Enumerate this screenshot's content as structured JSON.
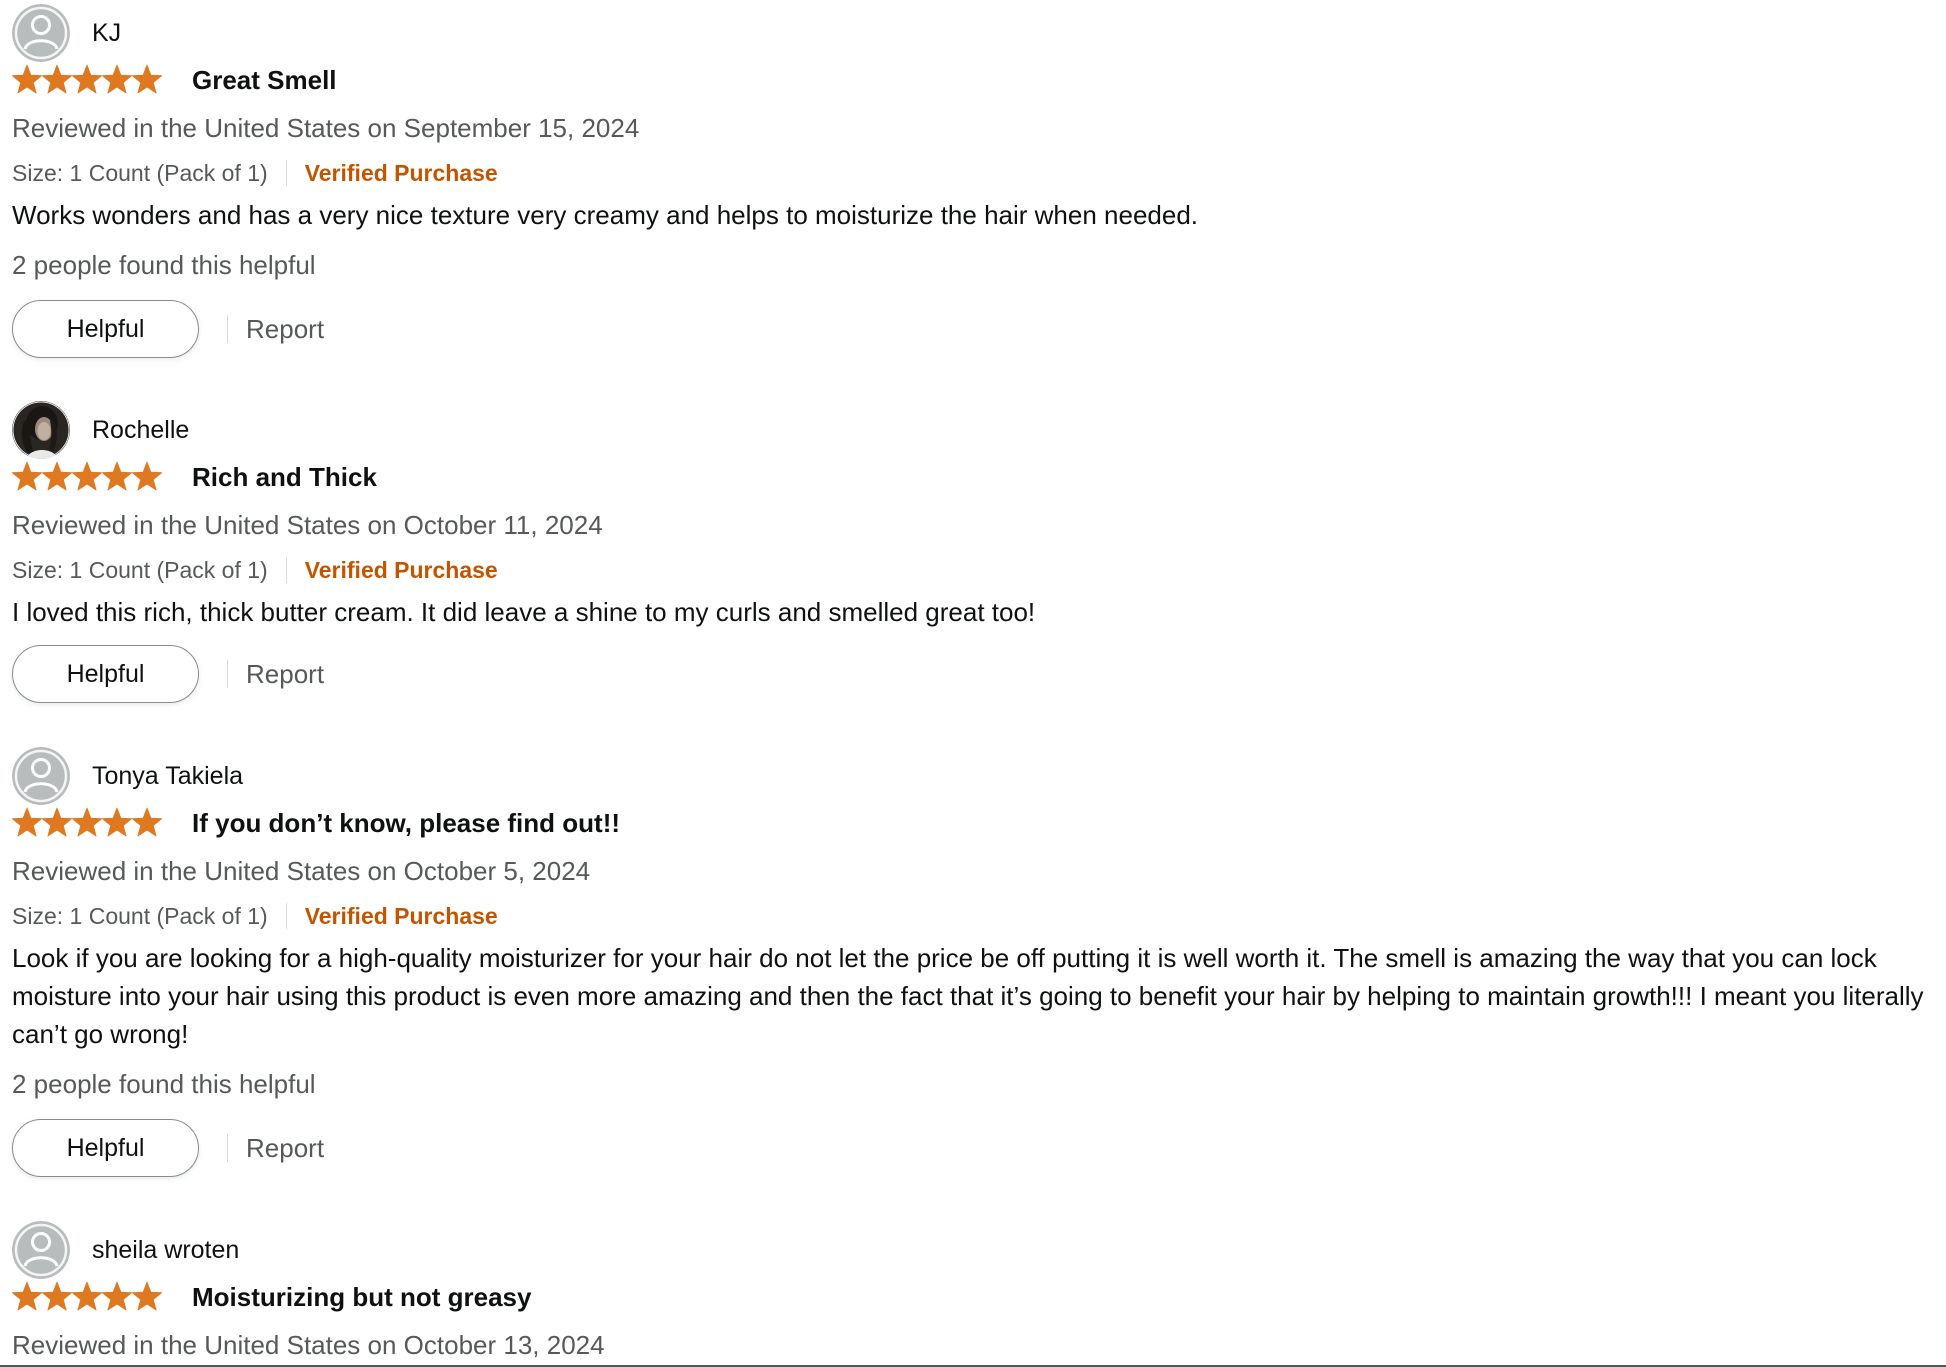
{
  "colors": {
    "star": "#de7921",
    "verified": "#c45500",
    "secondary_text": "#565959",
    "primary_text": "#0f1111"
  },
  "reviews": [
    {
      "avatar": "default-user-icon",
      "profile_name": "KJ",
      "rating": 5,
      "title": "Great Smell",
      "date": "Reviewed in the United States on September 15, 2024",
      "size": "Size: 1 Count (Pack of 1)",
      "verified": "Verified Purchase",
      "body": "Works wonders and has a very nice texture very creamy and helps to moisturize the hair when needed.",
      "helpful_count": "2 people found this helpful",
      "helpful_label": "Helpful",
      "report_label": "Report"
    },
    {
      "avatar": "profile-photo",
      "profile_name": "Rochelle",
      "rating": 5,
      "title": "Rich and Thick",
      "date": "Reviewed in the United States on October 11, 2024",
      "size": "Size: 1 Count (Pack of 1)",
      "verified": "Verified Purchase",
      "body": "I loved this rich, thick butter cream. It did leave a shine to my curls and smelled great too!",
      "helpful_label": "Helpful",
      "report_label": "Report"
    },
    {
      "avatar": "default-user-icon",
      "profile_name": "Tonya Takiela",
      "rating": 5,
      "title": "If you don’t know, please find out!!",
      "date": "Reviewed in the United States on October 5, 2024",
      "size": "Size: 1 Count (Pack of 1)",
      "verified": "Verified Purchase",
      "body": "Look if you are looking for a high-quality moisturizer for your hair do not let the price be off putting it is well worth it. The smell is amazing the way that you can lock moisture into your hair using this product is even more amazing and then the fact that it’s going to benefit your hair by helping to maintain growth!!! I meant you literally can’t go wrong!",
      "helpful_count": "2 people found this helpful",
      "helpful_label": "Helpful",
      "report_label": "Report"
    },
    {
      "avatar": "default-user-icon",
      "profile_name": "sheila wroten",
      "rating": 5,
      "title": "Moisturizing but not greasy",
      "date": "Reviewed in the United States on October 13, 2024"
    }
  ]
}
